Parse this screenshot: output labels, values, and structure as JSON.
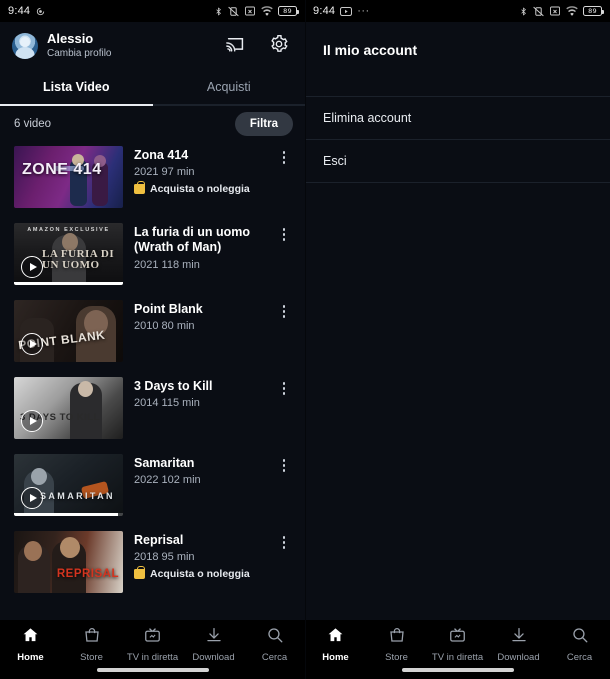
{
  "status_bar_left": {
    "time": "9:44",
    "left_icons": [
      "notification-sync-icon"
    ],
    "right_icons": [
      "bluetooth-icon",
      "vibrate-off-icon",
      "no-sim-icon",
      "wifi-icon"
    ],
    "battery_level": "89"
  },
  "status_bar_right": {
    "time": "9:44",
    "left_icons": [
      "youtube-play-icon",
      "overflow-dots-icon"
    ],
    "right_icons": [
      "bluetooth-icon",
      "vibrate-off-icon",
      "no-sim-icon",
      "wifi-icon"
    ],
    "battery_level": "89"
  },
  "left_panel": {
    "profile": {
      "name": "Alessio",
      "subtitle": "Cambia profilo",
      "avatar_icon": "user-avatar-icon"
    },
    "header_actions": [
      {
        "name": "cast-button",
        "icon": "cast-icon"
      },
      {
        "name": "settings-button",
        "icon": "gear-icon"
      }
    ],
    "tabs": [
      {
        "label": "Lista Video",
        "active": true
      },
      {
        "label": "Acquisti",
        "active": false
      }
    ],
    "list_header": {
      "count_label": "6 video",
      "filter_label": "Filtra"
    },
    "videos": [
      {
        "title": "Zona 414",
        "meta": "2021 97 min",
        "offer": "Acquista o noleggia",
        "poster_text": "ZONE 414",
        "has_play": false,
        "progress": null,
        "art_class": "art-zona"
      },
      {
        "title": "La furia di un uomo (Wrath of Man)",
        "meta": "2021 118 min",
        "offer": null,
        "poster_text": "LA FURIA DI UN UOMO",
        "poster_banner": "AMAZON EXCLUSIVE",
        "has_play": true,
        "progress": 100,
        "art_class": "art-furia"
      },
      {
        "title": "Point Blank",
        "meta": "2010 80 min",
        "offer": null,
        "poster_text": "POINT BLANK",
        "has_play": true,
        "progress": null,
        "art_class": "art-point"
      },
      {
        "title": "3 Days to Kill",
        "meta": "2014 115 min",
        "offer": null,
        "poster_text": "3 DAYS TO KILL",
        "has_play": true,
        "progress": null,
        "art_class": "art-3days"
      },
      {
        "title": "Samaritan",
        "meta": "2022 102 min",
        "offer": null,
        "poster_text": "SAMARITAN",
        "has_play": true,
        "progress": 95,
        "art_class": "art-sama"
      },
      {
        "title": "Reprisal",
        "meta": "2018 95 min",
        "offer": "Acquista o noleggia",
        "poster_text": "REPRISAL",
        "has_play": false,
        "progress": null,
        "art_class": "art-repri"
      }
    ]
  },
  "right_panel": {
    "title": "Il mio account",
    "menu": [
      {
        "label": "Elimina account"
      },
      {
        "label": "Esci"
      }
    ]
  },
  "bottom_nav": [
    {
      "label": "Home",
      "icon": "home-icon",
      "active": true
    },
    {
      "label": "Store",
      "icon": "bag-icon",
      "active": false
    },
    {
      "label": "TV in diretta",
      "icon": "tv-icon",
      "active": false
    },
    {
      "label": "Download",
      "icon": "download-icon",
      "active": false
    },
    {
      "label": "Cerca",
      "icon": "search-icon",
      "active": false
    }
  ],
  "colors": {
    "background": "#0a0d14",
    "status_bar": "#000000",
    "accent_white": "#ffffff",
    "muted_text": "#a9b1bd",
    "filter_chip": "#323842",
    "offer_gold": "#f0c040"
  }
}
